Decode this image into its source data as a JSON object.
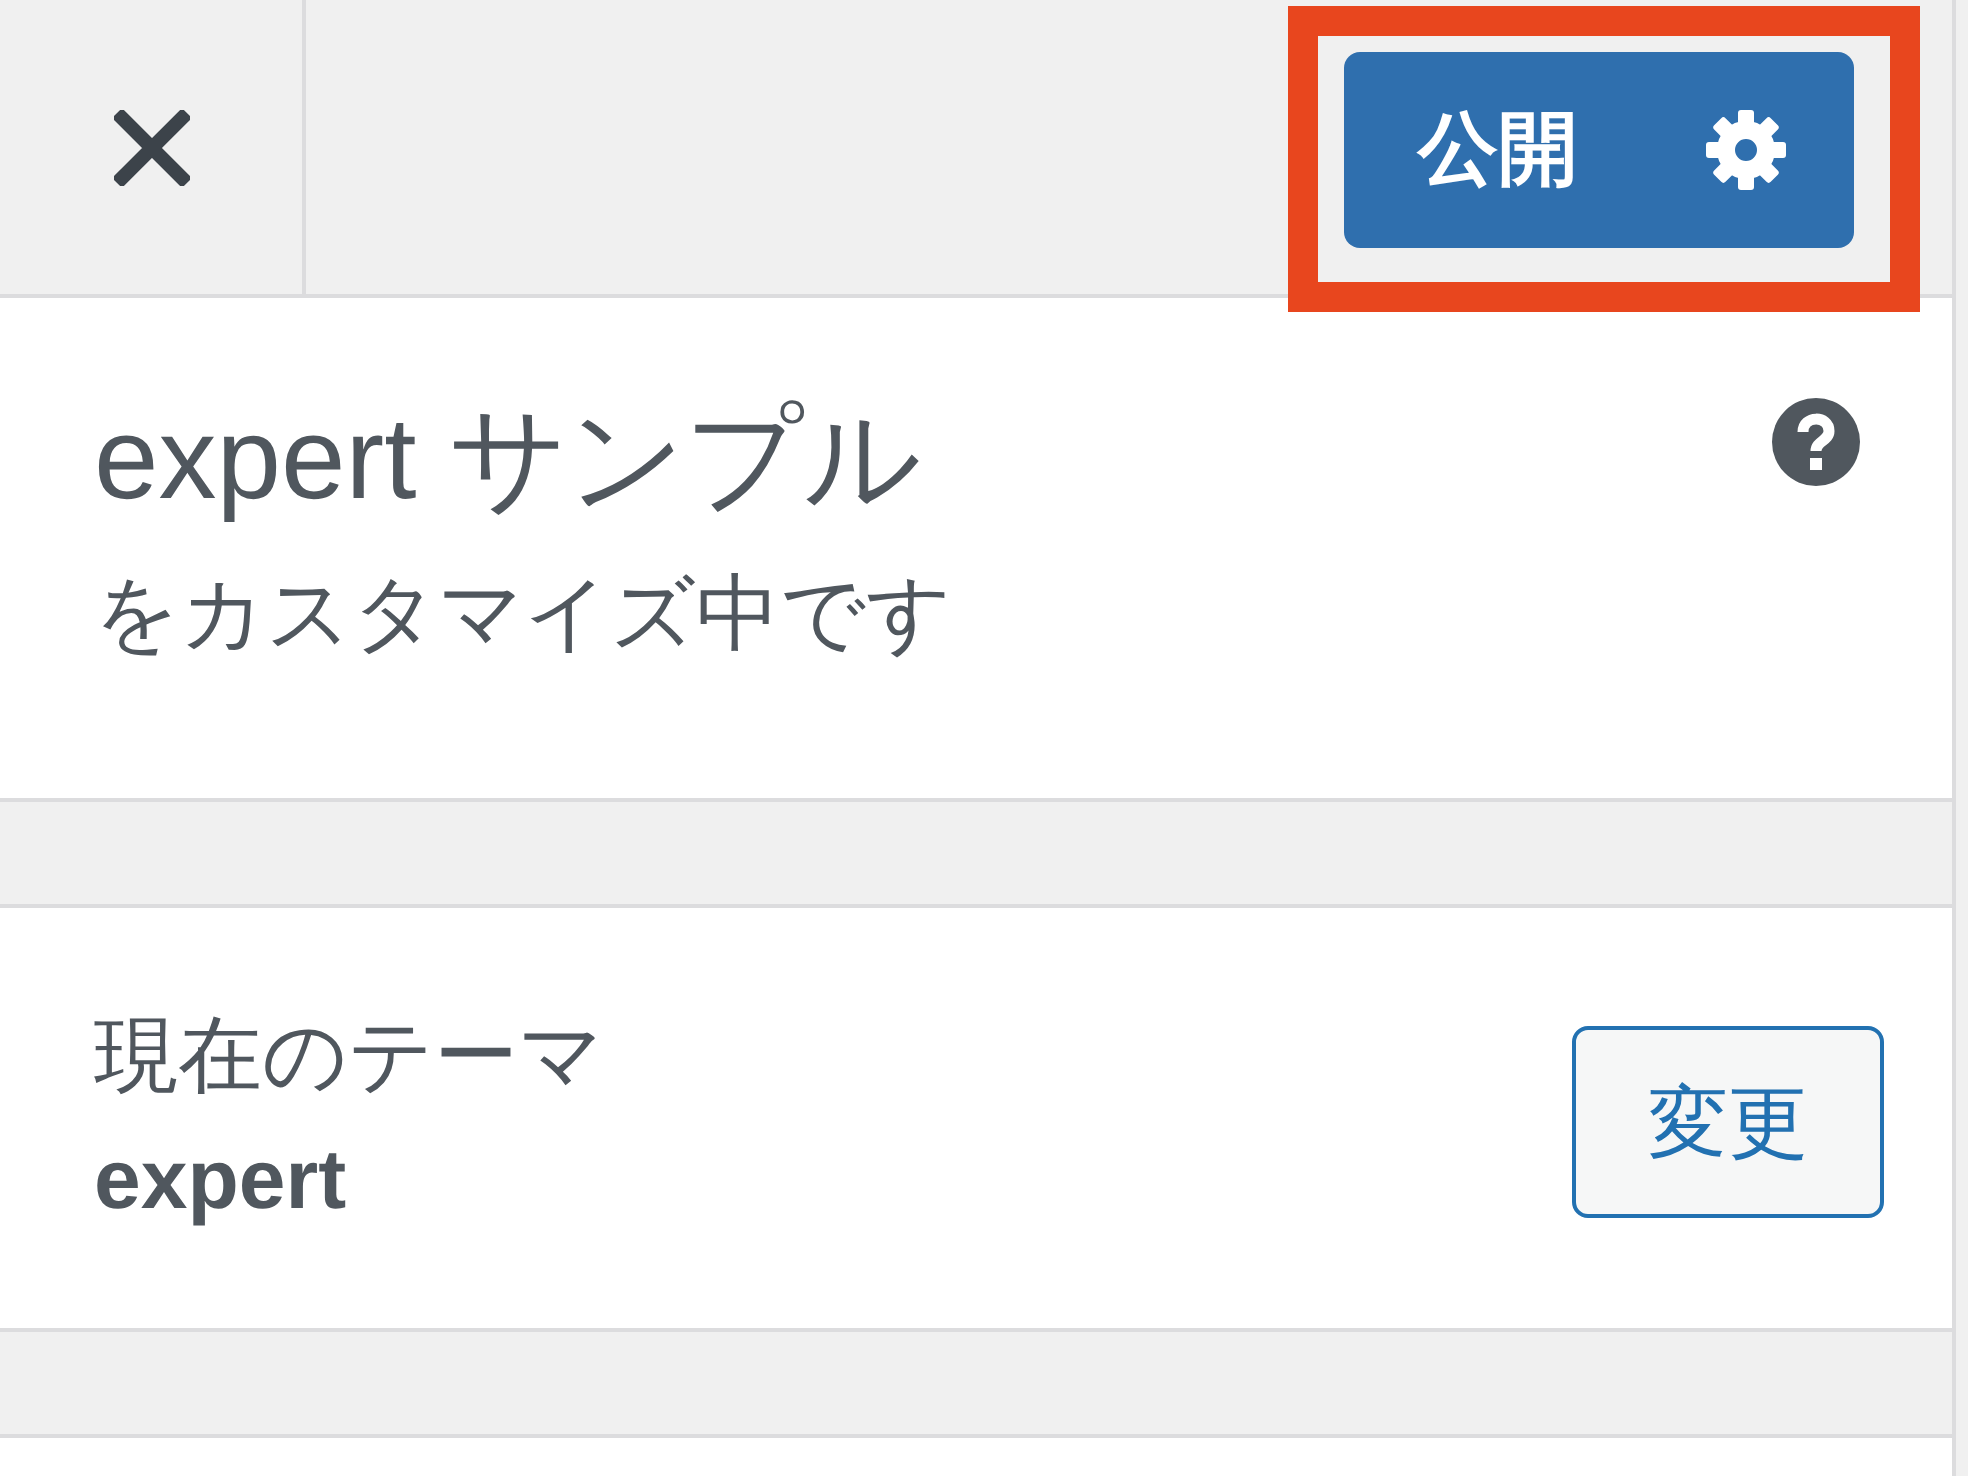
{
  "header": {
    "publish_button": {
      "label": "公開",
      "highlighted": true
    }
  },
  "info": {
    "title": "expert サンプル",
    "subtitle": "をカスタマイズ中です"
  },
  "theme": {
    "label": "現在のテーマ",
    "name": "expert",
    "button": "変更"
  }
}
